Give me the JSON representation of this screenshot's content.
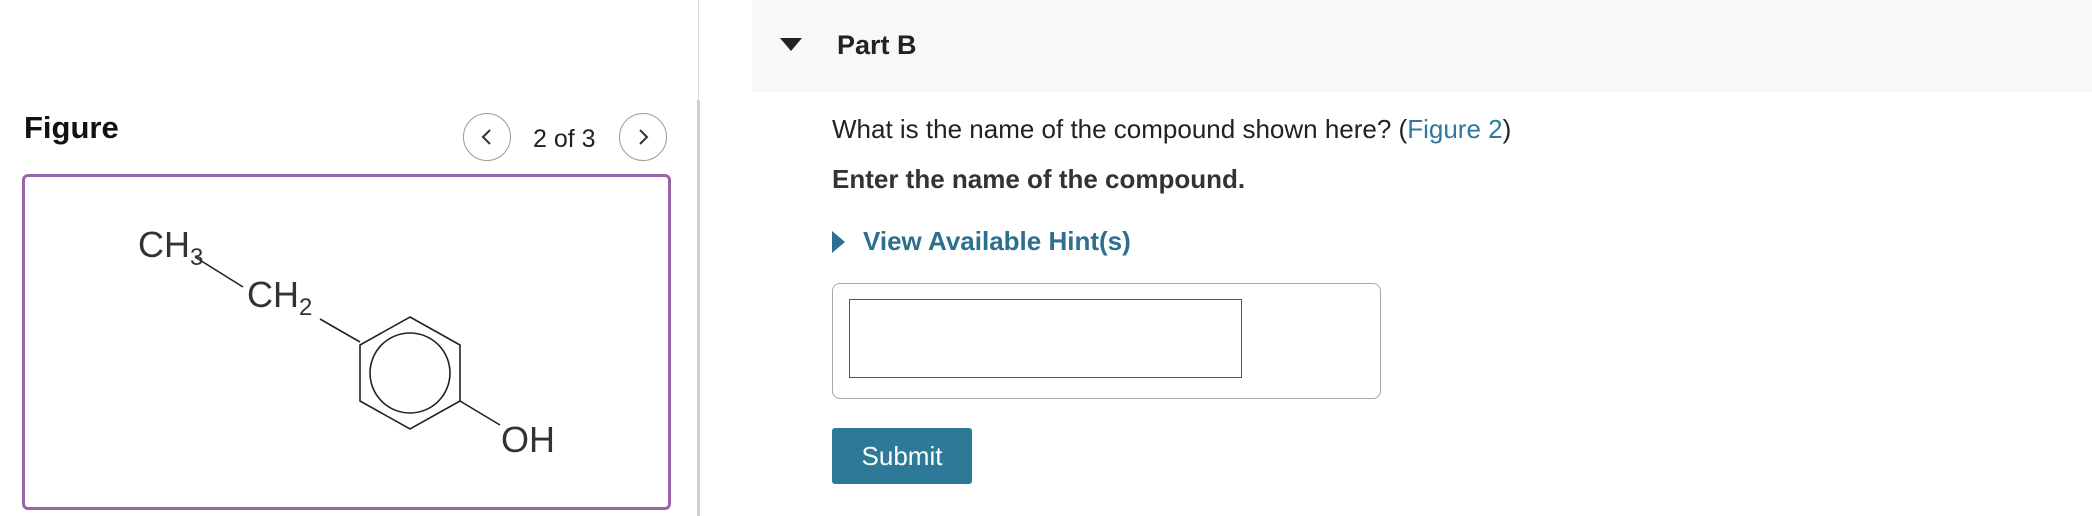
{
  "figure_panel": {
    "title": "Figure",
    "counter": "2 of 3",
    "structure": {
      "label_ch3": "CH",
      "sub_3": "3",
      "label_ch2": "CH",
      "sub_2": "2",
      "label_oh": "OH"
    }
  },
  "part": {
    "title": "Part B",
    "question_prefix": "What is the name of the compound shown here? (",
    "figure_link": "Figure 2",
    "question_suffix": ")",
    "instruction": "Enter the name of the compound.",
    "hint_label": "View Available Hint(s)",
    "answer_value": "",
    "submit_label": "Submit"
  },
  "colors": {
    "accent": "#2e7898",
    "link": "#2d7a9a",
    "figure_border": "#9b64a8"
  },
  "icons": {
    "prev": "chevron-left-icon",
    "next": "chevron-right-icon",
    "collapse": "caret-down-icon",
    "hint_toggle": "caret-right-icon"
  }
}
